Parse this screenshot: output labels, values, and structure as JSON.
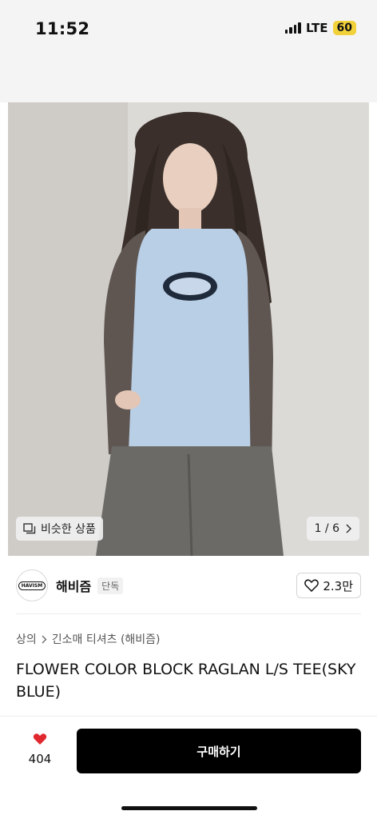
{
  "status_bar": {
    "time": "11:52",
    "network": "LTE",
    "battery": "60"
  },
  "gallery": {
    "similar_label": "비슷한 상품",
    "page_indicator": "1 / 6"
  },
  "brand": {
    "logo_text": "HAVISM",
    "name": "해비즘",
    "badge": "단독",
    "likes": "2.3만"
  },
  "breadcrumb": {
    "level1": "상의",
    "level2": "긴소매 티셔츠 (해비즘)"
  },
  "product": {
    "title": "FLOWER COLOR BLOCK RAGLAN L/S TEE(SKY BLUE)"
  },
  "bottom_bar": {
    "like_count": "404",
    "buy_label": "구매하기"
  },
  "colors": {
    "accent": "#000000",
    "heart": "#e0282e",
    "battery": "#f2d23a"
  },
  "icons": [
    "signal-icon",
    "heart-outline-icon",
    "heart-filled-icon",
    "similar-icon",
    "chevron-right-icon"
  ]
}
